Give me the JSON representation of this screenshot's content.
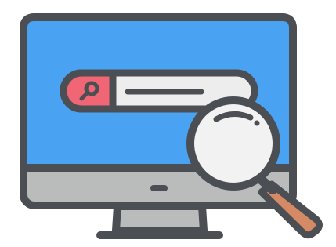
{
  "illustration": {
    "subject": "monitor-with-search-bar-and-magnifier",
    "icons": {
      "monitor": "monitor-icon",
      "search_bar": "search-bar-icon",
      "search_button": "search-button-icon",
      "magnifier": "magnifying-glass-icon"
    },
    "colors": {
      "outline": "#4b4f54",
      "screen": "#4aa3f2",
      "bezel": "#b9bcbb",
      "stand": "#b9bcbb",
      "search_field": "#ededed",
      "search_button": "#f06674",
      "lens": "#f2f2f2",
      "handle": "#d58a66",
      "background": "#ffffff"
    }
  }
}
